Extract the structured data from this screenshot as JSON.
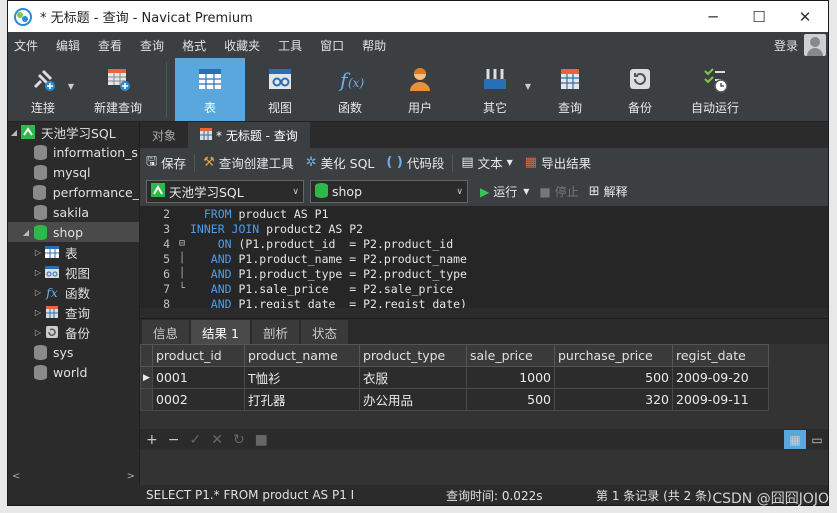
{
  "window": {
    "title": "* 无标题 - 查询 - Navicat Premium"
  },
  "menu": [
    "文件",
    "编辑",
    "查看",
    "查询",
    "格式",
    "收藏夹",
    "工具",
    "窗口",
    "帮助"
  ],
  "login": "登录",
  "toolbar": [
    {
      "label": "连接",
      "icon": "plug-icon"
    },
    {
      "label": "新建查询",
      "icon": "new-query-icon"
    },
    {
      "label": "表",
      "icon": "table-icon"
    },
    {
      "label": "视图",
      "icon": "view-icon"
    },
    {
      "label": "函数",
      "icon": "function-icon"
    },
    {
      "label": "用户",
      "icon": "user-icon"
    },
    {
      "label": "其它",
      "icon": "tools-icon"
    },
    {
      "label": "查询",
      "icon": "query-icon"
    },
    {
      "label": "备份",
      "icon": "backup-icon"
    },
    {
      "label": "自动运行",
      "icon": "schedule-icon"
    }
  ],
  "tree": {
    "connection": "天池学习SQL",
    "databases": [
      "information_s",
      "mysql",
      "performance_",
      "sakila",
      "shop",
      "sys",
      "world"
    ],
    "shop_children": [
      "表",
      "视图",
      "函数",
      "查询",
      "备份"
    ]
  },
  "tabs": {
    "objects": "对象",
    "query": "* 无标题 - 查询"
  },
  "qtool": {
    "save": "保存",
    "builder": "查询创建工具",
    "beautify": "美化 SQL",
    "snippet": "代码段",
    "text": "文本",
    "export": "导出结果"
  },
  "selectors": {
    "connection": "天池学习SQL",
    "database": "shop",
    "run": "运行",
    "stop": "停止",
    "explain": "解释"
  },
  "sql_lines": [
    {
      "n": "2",
      "kw": "FROM",
      "pre": "  ",
      "rest": " product AS P1",
      "fold": ""
    },
    {
      "n": "3",
      "kw": "INNER JOIN",
      "pre": "",
      "rest": " product2 AS P2",
      "fold": ""
    },
    {
      "n": "4",
      "kw": "ON",
      "pre": "    ",
      "rest": " (P1.product_id  = P2.product_id",
      "fold": "⊟"
    },
    {
      "n": "5",
      "kw": "AND",
      "pre": "   ",
      "rest": " P1.product_name = P2.product_name",
      "fold": "│"
    },
    {
      "n": "6",
      "kw": "AND",
      "pre": "   ",
      "rest": " P1.product_type = P2.product_type",
      "fold": "│"
    },
    {
      "n": "7",
      "kw": "AND",
      "pre": "   ",
      "rest": " P1.sale_price   = P2.sale_price",
      "fold": "└"
    },
    {
      "n": "8",
      "kw": "AND",
      "pre": "   ",
      "rest": " P1.regist_date  = P2.regist_date)",
      "fold": ""
    }
  ],
  "result_tabs": [
    "信息",
    "结果 1",
    "剖析",
    "状态"
  ],
  "result": {
    "columns": [
      "product_id",
      "product_name",
      "product_type",
      "sale_price",
      "purchase_price",
      "regist_date"
    ],
    "rows": [
      [
        "0001",
        "T恤衫",
        "衣服",
        "1000",
        "500",
        "2009-09-20"
      ],
      [
        "0002",
        "打孔器",
        "办公用品",
        "500",
        "320",
        "2009-09-11"
      ]
    ]
  },
  "status": {
    "sql": "SELECT P1.*   FROM product AS P1  I",
    "time": "查询时间: 0.022s",
    "record": "第 1 条记录 (共 2 条)"
  },
  "watermark": "CSDN @囧囧JOJO"
}
